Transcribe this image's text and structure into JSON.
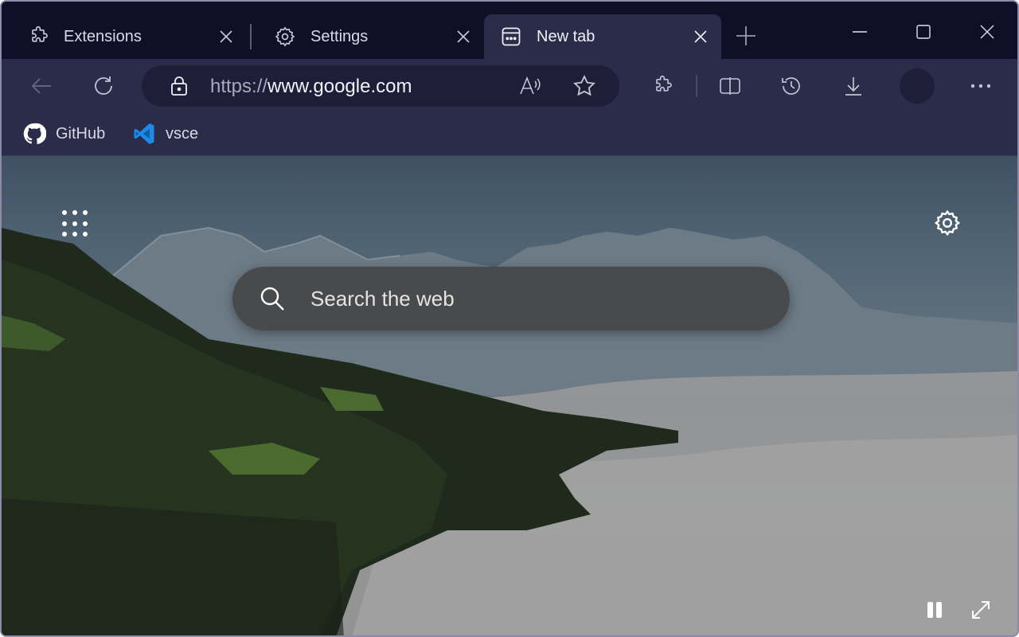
{
  "tabs": [
    {
      "label": "Extensions",
      "icon": "puzzle-icon",
      "active": false
    },
    {
      "label": "Settings",
      "icon": "gear-icon",
      "active": false
    },
    {
      "label": "New tab",
      "icon": "newtab-page-icon",
      "active": true
    }
  ],
  "window_controls": {
    "minimize": "minimize-icon",
    "maximize": "maximize-icon",
    "close": "close-icon"
  },
  "toolbar": {
    "back": "back-arrow-icon",
    "refresh": "refresh-icon",
    "url_protocol": "https://",
    "url_host": "www.google.com",
    "read_aloud": "read-aloud-icon",
    "favorite": "star-icon",
    "extensions": "puzzle-icon",
    "split_screen": "split-screen-icon",
    "history": "history-icon",
    "downloads": "download-icon",
    "more": "more-horizontal-icon"
  },
  "favorites": [
    {
      "label": "GitHub",
      "icon": "github-icon"
    },
    {
      "label": "vsce",
      "icon": "vscode-icon"
    }
  ],
  "newtab": {
    "search_placeholder": "Search the web",
    "apps_icon": "apps-grid-icon",
    "settings_icon": "gear-icon",
    "pause_icon": "pause-icon",
    "expand_icon": "expand-icon"
  },
  "colors": {
    "titlebar": "#0f0f28",
    "toolbar": "#2b2b4a",
    "addressbar": "#1e1e38",
    "searchbox": "#464646",
    "vscode_blue": "#2196f3"
  }
}
